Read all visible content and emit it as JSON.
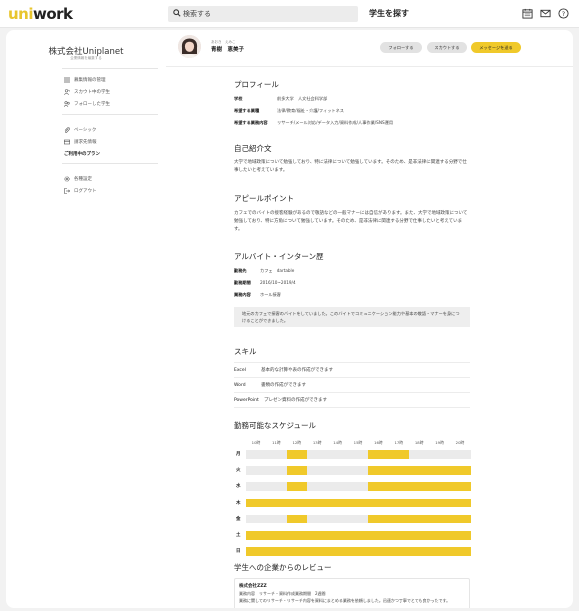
{
  "header": {
    "logo_part1": "uni",
    "logo_part2": "work",
    "search_placeholder": "検索する",
    "find_students": "学生を探す"
  },
  "sidebar": {
    "company_name": "株式会社Uniplanet",
    "company_sub": "企業情報を編集する",
    "items": [
      {
        "label": "募集情報の管理",
        "icon": "list-icon"
      },
      {
        "label": "スカウト中の学生",
        "icon": "user-scout-icon"
      },
      {
        "label": "フォローした学生",
        "icon": "users-icon"
      },
      {
        "label": "ベーシック",
        "icon": "paperclip-icon"
      },
      {
        "label": "請求先情報",
        "icon": "card-icon"
      },
      {
        "label": "ご利用中のプラン",
        "icon": ""
      },
      {
        "label": "各種設定",
        "icon": "gear-icon"
      },
      {
        "label": "ログアウト",
        "icon": "logout-icon"
      }
    ]
  },
  "profile": {
    "kana": "あおき　えみこ",
    "name": "青樹　恵美子",
    "follow_label": "フォローする",
    "scout_label": "スカウトする",
    "message_label": "メッセージを送る"
  },
  "sections": {
    "profile_title": "プロフィール",
    "school_label": "学校",
    "school_value": "前多大学　人文社会科学部",
    "industry_label": "希望する業種",
    "industry_value": "法律/教育/福祉・介護/フィットネス",
    "work_label": "希望する業務内容",
    "work_value": "リサーチ/メール対応/データ入力/資料作成/人事作業/SNS運用",
    "intro_title": "自己紹介文",
    "intro_text": "大学で地域政策について勉強しており、特に法律について勉強しています。そのため、是非法律に関連する分野で仕事したいと考えています。",
    "appeal_title": "アピールポイント",
    "appeal_text": "カフェでのバイトの接客経験があるので敬語などの一般マナーには自信があります。また、大学で地域政策について勉強しており、特に方角について勉強しています。そのため、是非法律に関連する分野で仕事したいと考えています。",
    "job_title": "アルバイト・インターン歴",
    "job_place_label": "勤務先",
    "job_place_value": "カフェ　dartable",
    "job_period_label": "勤務期間",
    "job_period_value": "2016/10~2019/4",
    "job_content_label": "業務内容",
    "job_content_value": "ホール接客",
    "job_quote": "地元のカフェで接客のバイトをしていました。このバイトでコミュニケーション能力や基本の敬語・マナーを身につけることができました。",
    "skill_title": "スキル",
    "skills": [
      {
        "name": "Excel",
        "desc": "基本的な計算や表の作成ができます"
      },
      {
        "name": "Word",
        "desc": "書類の作成ができます"
      },
      {
        "name": "PowerPoint",
        "desc": "プレゼン資料の作成ができます"
      }
    ],
    "schedule_title": "勤務可能なスケジュール",
    "review_title": "学生への企業からのレビュー",
    "review_company": "株式会社ZZZ",
    "review_meta": "業務内容　リサーチ・資料作成業務期間　2週間",
    "review_text": "業務に関してのリサーチ・リサーチ内容を資料にまとめる業務を依頼しました。迅速かつ丁寧でとても良かったです。"
  },
  "schedule": {
    "hours": [
      "10時",
      "11時",
      "12時",
      "13時",
      "14時",
      "15時",
      "16時",
      "17時",
      "18時",
      "19時",
      "20時"
    ],
    "days": [
      "月",
      "火",
      "水",
      "木",
      "金",
      "土",
      "日"
    ],
    "available": [
      [
        0,
        0,
        1,
        0,
        0,
        0,
        1,
        1,
        0,
        0,
        0
      ],
      [
        0,
        0,
        1,
        0,
        0,
        0,
        1,
        1,
        1,
        1,
        1
      ],
      [
        0,
        0,
        1,
        0,
        0,
        0,
        1,
        1,
        1,
        1,
        1
      ],
      [
        1,
        1,
        1,
        1,
        1,
        1,
        1,
        1,
        1,
        1,
        1
      ],
      [
        0,
        0,
        1,
        0,
        0,
        0,
        1,
        1,
        1,
        1,
        1
      ],
      [
        1,
        1,
        1,
        1,
        1,
        1,
        1,
        1,
        1,
        1,
        1
      ],
      [
        1,
        1,
        1,
        1,
        1,
        1,
        1,
        1,
        1,
        1,
        1
      ]
    ],
    "on_color": "#f0c92a",
    "off_color": "#ebebeb"
  },
  "colors": {
    "accent": "#f0c92a"
  }
}
